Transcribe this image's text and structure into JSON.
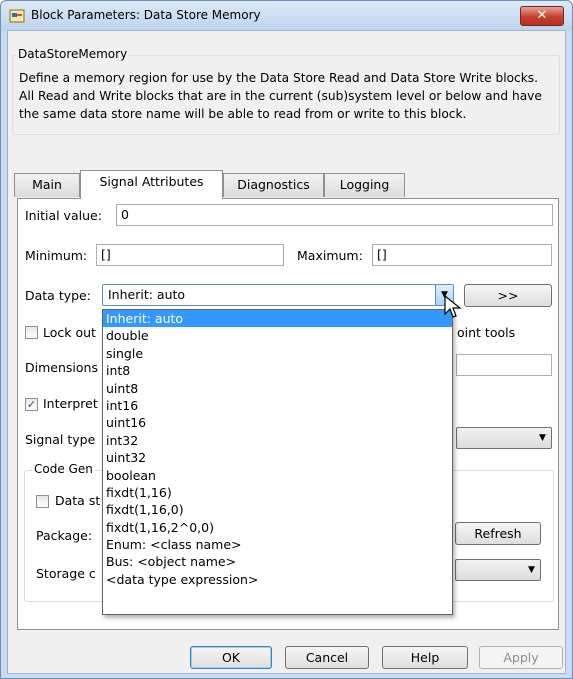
{
  "window": {
    "title": "Block Parameters: Data Store Memory",
    "close_label": "✕"
  },
  "group": {
    "legend": "DataStoreMemory",
    "description": "Define a memory region for use by the Data Store Read and Data Store Write blocks. All Read and Write blocks that are in the current (sub)system level or below and have the same data store name will be able to read from or write to this block."
  },
  "tabs": [
    {
      "label": "Main",
      "active": false
    },
    {
      "label": "Signal Attributes",
      "active": true
    },
    {
      "label": "Diagnostics",
      "active": false
    },
    {
      "label": "Logging",
      "active": false
    }
  ],
  "signal": {
    "initial_value_label": "Initial value:",
    "initial_value": "0",
    "minimum_label": "Minimum:",
    "minimum": "[]",
    "maximum_label": "Maximum:",
    "maximum": "[]",
    "data_type_label": "Data type:",
    "data_type": "Inherit: auto",
    "assistant_button": ">>",
    "lock_label": "Lock out",
    "lock_tail": "oint tools",
    "dimensions_label": "Dimensions",
    "interpret_label": "Interpret",
    "signal_type_label": "Signal type"
  },
  "codegen": {
    "legend": "Code Gen",
    "data_store_label": "Data st",
    "package_label": "Package:",
    "refresh_button": "Refresh",
    "storage_label": "Storage c"
  },
  "dropdown": {
    "items": [
      "Inherit: auto",
      "double",
      "single",
      "int8",
      "uint8",
      "int16",
      "uint16",
      "int32",
      "uint32",
      "boolean",
      "fixdt(1,16)",
      "fixdt(1,16,0)",
      "fixdt(1,16,2^0,0)",
      "Enum: <class name>",
      "Bus: <object name>",
      "<data type expression>"
    ],
    "selected_index": 0
  },
  "buttons": {
    "ok": "OK",
    "cancel": "Cancel",
    "help": "Help",
    "apply": "Apply"
  },
  "icons": {
    "app": "simulink-block-icon",
    "combo": "chevron-down-icon",
    "close": "close-icon",
    "cursor": "mouse-pointer-icon"
  },
  "colors": {
    "selection": "#3399ff",
    "close_button": "#c4402b",
    "window_frame": "#c9dcf0"
  }
}
